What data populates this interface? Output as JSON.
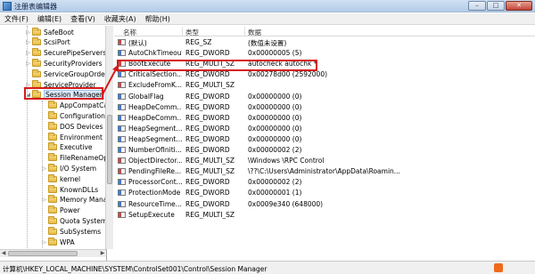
{
  "window": {
    "title": "注册表编辑器",
    "buttons": {
      "minimize": "–",
      "maximize": "□",
      "close": "✕"
    }
  },
  "menu": [
    "文件(F)",
    "编辑(E)",
    "查看(V)",
    "收藏夹(A)",
    "帮助(H)"
  ],
  "tree": {
    "items": [
      {
        "label": "SafeBoot",
        "expander": "▷"
      },
      {
        "label": "ScsiPort",
        "expander": "▷"
      },
      {
        "label": "SecurePipeServers",
        "expander": "▷"
      },
      {
        "label": "SecurityProviders",
        "expander": "▷"
      },
      {
        "label": "ServiceGroupOrder",
        "expander": ""
      },
      {
        "label": "ServiceProvider",
        "expander": "▷"
      },
      {
        "label": "Session Manager",
        "expander": "◢",
        "selected": true
      },
      {
        "label": "AppCompatCac",
        "expander": ""
      },
      {
        "label": "Configuration M",
        "expander": ""
      },
      {
        "label": "DOS Devices",
        "expander": ""
      },
      {
        "label": "Environment",
        "expander": ""
      },
      {
        "label": "Executive",
        "expander": ""
      },
      {
        "label": "FileRenameOper",
        "expander": ""
      },
      {
        "label": "I/O System",
        "expander": "▷"
      },
      {
        "label": "kernel",
        "expander": ""
      },
      {
        "label": "KnownDLLs",
        "expander": ""
      },
      {
        "label": "Memory Manag",
        "expander": "▷"
      },
      {
        "label": "Power",
        "expander": ""
      },
      {
        "label": "Quota System",
        "expander": ""
      },
      {
        "label": "SubSystems",
        "expander": ""
      },
      {
        "label": "WPA",
        "expander": "▷"
      }
    ]
  },
  "list": {
    "columns": [
      "名称",
      "类型",
      "数据"
    ],
    "rows": [
      {
        "name": "(默认)",
        "type": "REG_SZ",
        "data": "(数值未设置)",
        "icon": "string-value-icon"
      },
      {
        "name": "AutoChkTimeout",
        "type": "REG_DWORD",
        "data": "0x00000005 (5)",
        "icon": "binary-value-icon"
      },
      {
        "name": "BootExecute",
        "type": "REG_MULTI_SZ",
        "data": "autocheck autochk *",
        "icon": "string-value-icon"
      },
      {
        "name": "CriticalSection...",
        "type": "REG_DWORD",
        "data": "0x00278d00 (2592000)",
        "icon": "binary-value-icon"
      },
      {
        "name": "ExcludeFromK...",
        "type": "REG_MULTI_SZ",
        "data": "",
        "icon": "string-value-icon"
      },
      {
        "name": "GlobalFlag",
        "type": "REG_DWORD",
        "data": "0x00000000 (0)",
        "icon": "binary-value-icon"
      },
      {
        "name": "HeapDeComm...",
        "type": "REG_DWORD",
        "data": "0x00000000 (0)",
        "icon": "binary-value-icon"
      },
      {
        "name": "HeapDeComm...",
        "type": "REG_DWORD",
        "data": "0x00000000 (0)",
        "icon": "binary-value-icon"
      },
      {
        "name": "HeapSegment...",
        "type": "REG_DWORD",
        "data": "0x00000000 (0)",
        "icon": "binary-value-icon"
      },
      {
        "name": "HeapSegment...",
        "type": "REG_DWORD",
        "data": "0x00000000 (0)",
        "icon": "binary-value-icon"
      },
      {
        "name": "NumberOfIniti...",
        "type": "REG_DWORD",
        "data": "0x00000002 (2)",
        "icon": "binary-value-icon"
      },
      {
        "name": "ObjectDirector...",
        "type": "REG_MULTI_SZ",
        "data": "\\Windows \\RPC Control",
        "icon": "string-value-icon"
      },
      {
        "name": "PendingFileRe...",
        "type": "REG_MULTI_SZ",
        "data": "\\??\\C:\\Users\\Administrator\\AppData\\Roamin...",
        "icon": "string-value-icon"
      },
      {
        "name": "ProcessorCont...",
        "type": "REG_DWORD",
        "data": "0x00000002 (2)",
        "icon": "binary-value-icon"
      },
      {
        "name": "ProtectionMode",
        "type": "REG_DWORD",
        "data": "0x00000001 (1)",
        "icon": "binary-value-icon"
      },
      {
        "name": "ResourceTime...",
        "type": "REG_DWORD",
        "data": "0x0009e340 (648000)",
        "icon": "binary-value-icon"
      },
      {
        "name": "SetupExecute",
        "type": "REG_MULTI_SZ",
        "data": "",
        "icon": "string-value-icon"
      }
    ]
  },
  "statusbar": {
    "path": "计算机\\HKEY_LOCAL_MACHINE\\SYSTEM\\ControlSet001\\Control\\Session Manager"
  },
  "colors": {
    "highlight": "#d51b1b",
    "selection": "#dde9f8"
  }
}
